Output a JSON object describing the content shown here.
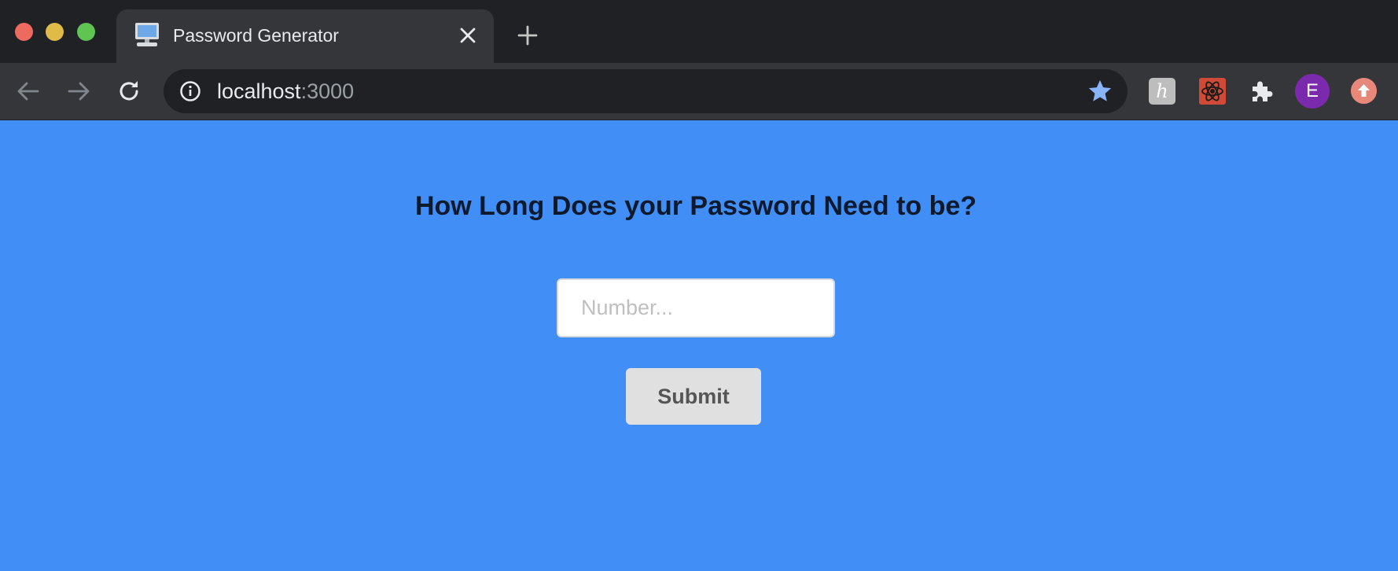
{
  "browser": {
    "tab": {
      "title": "Password Generator",
      "favicon": "computer-icon"
    },
    "address_bar": {
      "host": "localhost",
      "port": ":3000"
    },
    "extensions": [
      {
        "icon": "h-extension-icon",
        "label": "h"
      },
      {
        "icon": "react-devtools-icon"
      },
      {
        "icon": "extensions-puzzle-icon"
      }
    ],
    "profile": {
      "initial": "E",
      "color": "#7b2aad"
    },
    "update_icon": "update-arrow-icon",
    "colors": {
      "tabstrip": "#202124",
      "toolbar": "#35363a",
      "star": "#8ab4f8"
    }
  },
  "page": {
    "background": "#418ef6",
    "heading": "How Long Does your Password Need to be?",
    "length_input": {
      "value": "",
      "placeholder": "Number..."
    },
    "submit_label": "Submit"
  }
}
